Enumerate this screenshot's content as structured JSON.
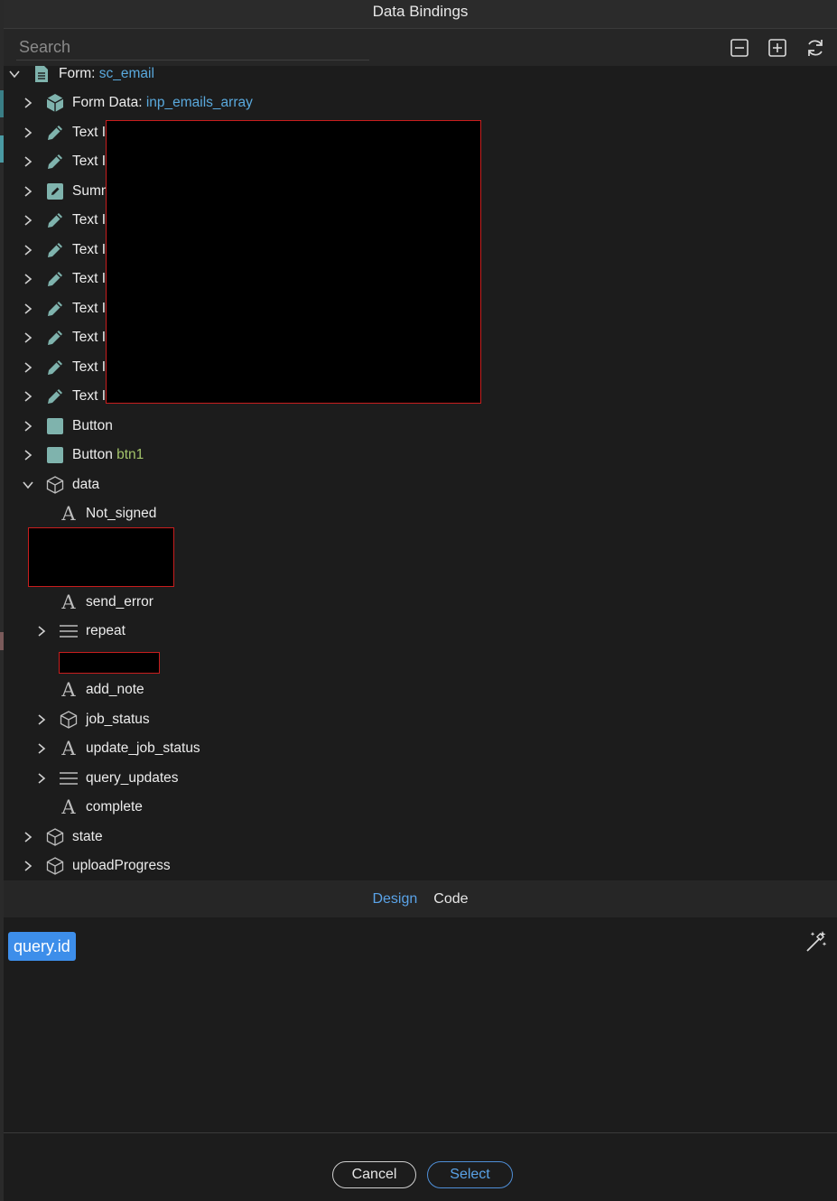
{
  "window": {
    "title": "Data Bindings"
  },
  "search": {
    "placeholder": "Search"
  },
  "toolbar": {
    "collapse_icon": "minus-square-icon",
    "expand_icon": "plus-square-icon",
    "refresh_icon": "refresh-icon"
  },
  "tree": {
    "form": {
      "label": "Form: ",
      "name": "sc_email"
    },
    "form_data": {
      "label": "Form Data: ",
      "name": "inp_emails_array"
    },
    "text_items": [
      "Text I",
      "Text I"
    ],
    "summ_item": "Summ",
    "text_items_2": [
      "Text I",
      "Text I",
      "Text I",
      "Text I",
      "Text I",
      "Text I",
      "Text I"
    ],
    "button_1": {
      "label": "Button"
    },
    "button_2": {
      "label": "Button ",
      "name": "btn1"
    },
    "data_node": {
      "label": "data"
    },
    "data_children": {
      "not_signed": "Not_signed",
      "send_error": "send_error",
      "repeat": "repeat",
      "add_note": "add_note",
      "job_status": "job_status",
      "update_job_status": "update_job_status",
      "query_updates": "query_updates",
      "complete": "complete"
    },
    "state": "state",
    "upload_progress": "uploadProgress"
  },
  "tabs": {
    "design": "Design",
    "code": "Code"
  },
  "editor": {
    "expression": "query.id"
  },
  "footer": {
    "cancel": "Cancel",
    "select": "Select"
  },
  "colors": {
    "accent": "#3d8eea",
    "link": "#5aa9dd",
    "green": "#a3c46a",
    "icon": "#7fb3ad",
    "redact_border": "#c81e1e"
  }
}
